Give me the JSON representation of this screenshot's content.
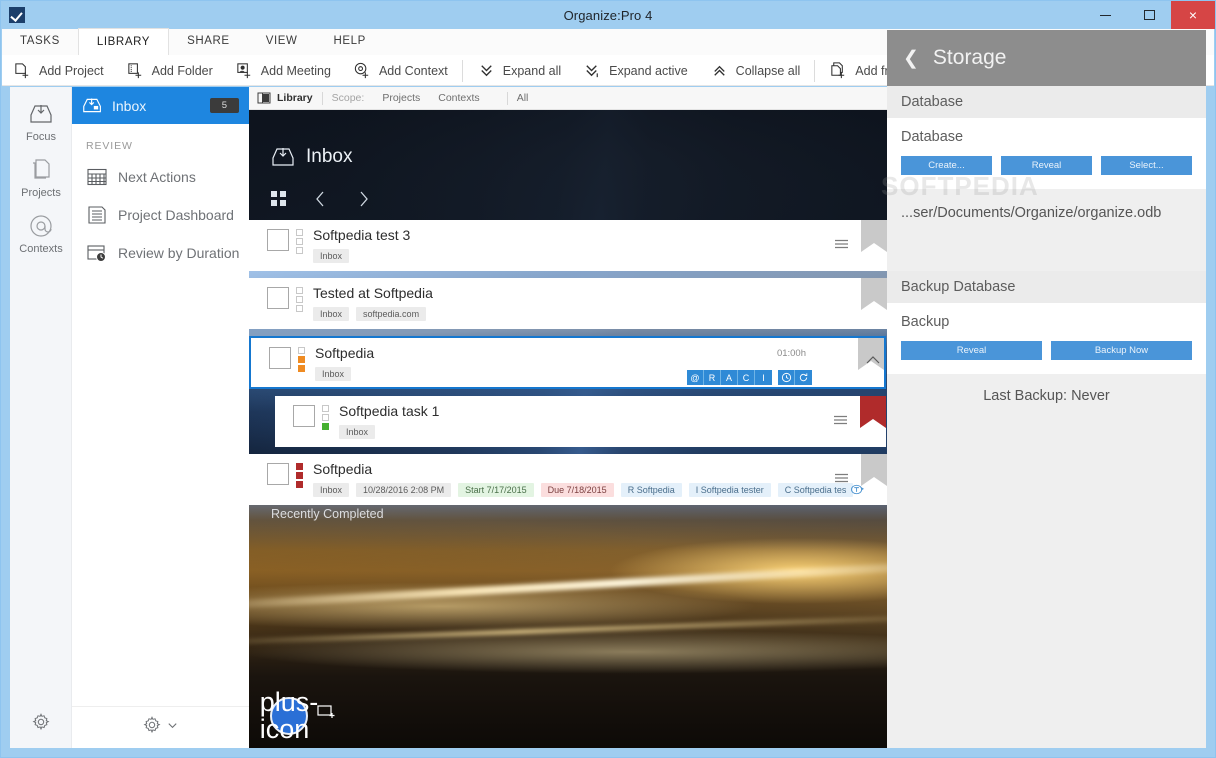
{
  "window": {
    "title": "Organize:Pro 4",
    "app_icon": "checkbox-icon",
    "minimize": "minimize-icon",
    "maximize": "maximize-icon",
    "close": "×"
  },
  "ribbon": {
    "tabs": [
      {
        "label": "TASKS",
        "active": false
      },
      {
        "label": "LIBRARY",
        "active": true
      },
      {
        "label": "SHARE",
        "active": false
      },
      {
        "label": "VIEW",
        "active": false
      },
      {
        "label": "HELP",
        "active": false
      }
    ],
    "buttons": [
      {
        "label": "Add Project",
        "icon": "add-project-icon"
      },
      {
        "label": "Add Folder",
        "icon": "add-folder-icon"
      },
      {
        "label": "Add Meeting",
        "icon": "add-meeting-icon"
      },
      {
        "label": "Add Context",
        "icon": "add-context-icon"
      },
      {
        "label": "Expand all",
        "icon": "chevron-double-down-icon"
      },
      {
        "label": "Expand active",
        "icon": "chevron-double-down-arrow-icon"
      },
      {
        "label": "Collapse all",
        "icon": "chevron-double-up-icon"
      },
      {
        "label": "Add from T",
        "icon": "add-from-template-icon"
      }
    ]
  },
  "rail": {
    "items": [
      {
        "label": "Focus",
        "icon": "inbox-tray-icon"
      },
      {
        "label": "Projects",
        "icon": "documents-icon"
      },
      {
        "label": "Contexts",
        "icon": "at-sign-icon"
      }
    ],
    "settings_icon": "gear-icon"
  },
  "sidebar": {
    "inbox": {
      "label": "Inbox",
      "count": "5",
      "icon": "inbox-lock-icon"
    },
    "section_label": "REVIEW",
    "items": [
      {
        "label": "Next Actions",
        "icon": "calendar-grid-icon"
      },
      {
        "label": "Project Dashboard",
        "icon": "lines-document-icon"
      },
      {
        "label": "Review by Duration",
        "icon": "calendar-clock-icon"
      }
    ],
    "footer": {
      "gear_icon": "gear-icon",
      "chevron_icon": "chevron-down-icon"
    }
  },
  "scopebar": {
    "icon": "panel-layout-icon",
    "library": "Library",
    "scope_label": "Scope:",
    "options": [
      "Projects",
      "Contexts"
    ],
    "all": "All"
  },
  "hero": {
    "title": "Inbox",
    "icon": "inbox-tray-icon",
    "grid_icon": "grid-view-icon",
    "prev_icon": "chevron-left-icon",
    "next_icon": "chevron-right-icon",
    "watermark": "SOFTPEDIA",
    "recently_completed": "Recently Completed"
  },
  "tasks": [
    {
      "title": "Softpedia test 3",
      "tags": [
        {
          "text": "Inbox",
          "kind": "plain"
        }
      ],
      "priority": [
        false,
        false,
        false
      ],
      "priority_color": "",
      "flag_color": "#c9c9c9",
      "has_hamburger": true,
      "selected": false,
      "nested": false
    },
    {
      "title": "Tested at Softpedia",
      "tags": [
        {
          "text": "Inbox",
          "kind": "plain"
        },
        {
          "text": "softpedia.com",
          "kind": "plain"
        }
      ],
      "priority": [
        false,
        false,
        false
      ],
      "priority_color": "",
      "flag_color": "#c9c9c9",
      "has_hamburger": false,
      "selected": false,
      "nested": false
    },
    {
      "title": "Softpedia",
      "tags": [
        {
          "text": "Inbox",
          "kind": "plain"
        }
      ],
      "priority": [
        false,
        true,
        true
      ],
      "priority_color": "#ef8b22",
      "flag_color": "#c9c9c9",
      "has_hamburger": false,
      "selected": true,
      "nested": false,
      "duration": "01:00h",
      "raci": [
        "@",
        "R",
        "A",
        "C",
        "I"
      ],
      "raci_extra": [
        "clock-icon",
        "repeat-icon"
      ],
      "collapse_icon": "chevron-up-icon"
    },
    {
      "title": "Softpedia task 1",
      "tags": [
        {
          "text": "Inbox",
          "kind": "plain"
        }
      ],
      "priority": [
        false,
        false,
        true
      ],
      "priority_color": "#45b030",
      "flag_color": "#b02b2b",
      "has_hamburger": true,
      "selected": false,
      "nested": true
    },
    {
      "title": "Softpedia",
      "tags": [
        {
          "text": "Inbox",
          "kind": "plain"
        },
        {
          "text": "10/28/2016 2:08 PM",
          "kind": "plain"
        },
        {
          "text": "Start 7/17/2015",
          "kind": "start"
        },
        {
          "text": "Due 7/18/2015",
          "kind": "due"
        },
        {
          "text": "R  Softpedia",
          "kind": "role"
        },
        {
          "text": "I  Softpedia tester",
          "kind": "role"
        },
        {
          "text": "C  Softpedia tes",
          "kind": "role"
        }
      ],
      "priority": [
        true,
        true,
        true
      ],
      "priority_color": "#b02b2b",
      "flag_color": "#c9c9c9",
      "has_hamburger": true,
      "selected": false,
      "nested": false,
      "clock_out_icon": "clock-out-icon"
    }
  ],
  "footer": {
    "add_icon": "plus-icon",
    "duplicate_icon": "duplicate-icon"
  },
  "storage": {
    "back_icon": "chevron-left-icon",
    "title": "Storage",
    "database_section": "Database",
    "database_card_title": "Database",
    "database_buttons": [
      "Create...",
      "Reveal",
      "Select..."
    ],
    "database_path": "...ser/Documents/Organize/organize.odb",
    "watermark": "SOFTPEDIA",
    "backup_section": "Backup Database",
    "backup_card_title": "Backup",
    "backup_buttons": [
      "Reveal",
      "Backup Now"
    ],
    "last_backup": "Last Backup: Never"
  },
  "colors": {
    "accent": "#1e86e0",
    "titlebar": "#9fcdf0",
    "close": "#d64545",
    "button": "#4a95d9",
    "panel_head": "#8d8d8d"
  }
}
